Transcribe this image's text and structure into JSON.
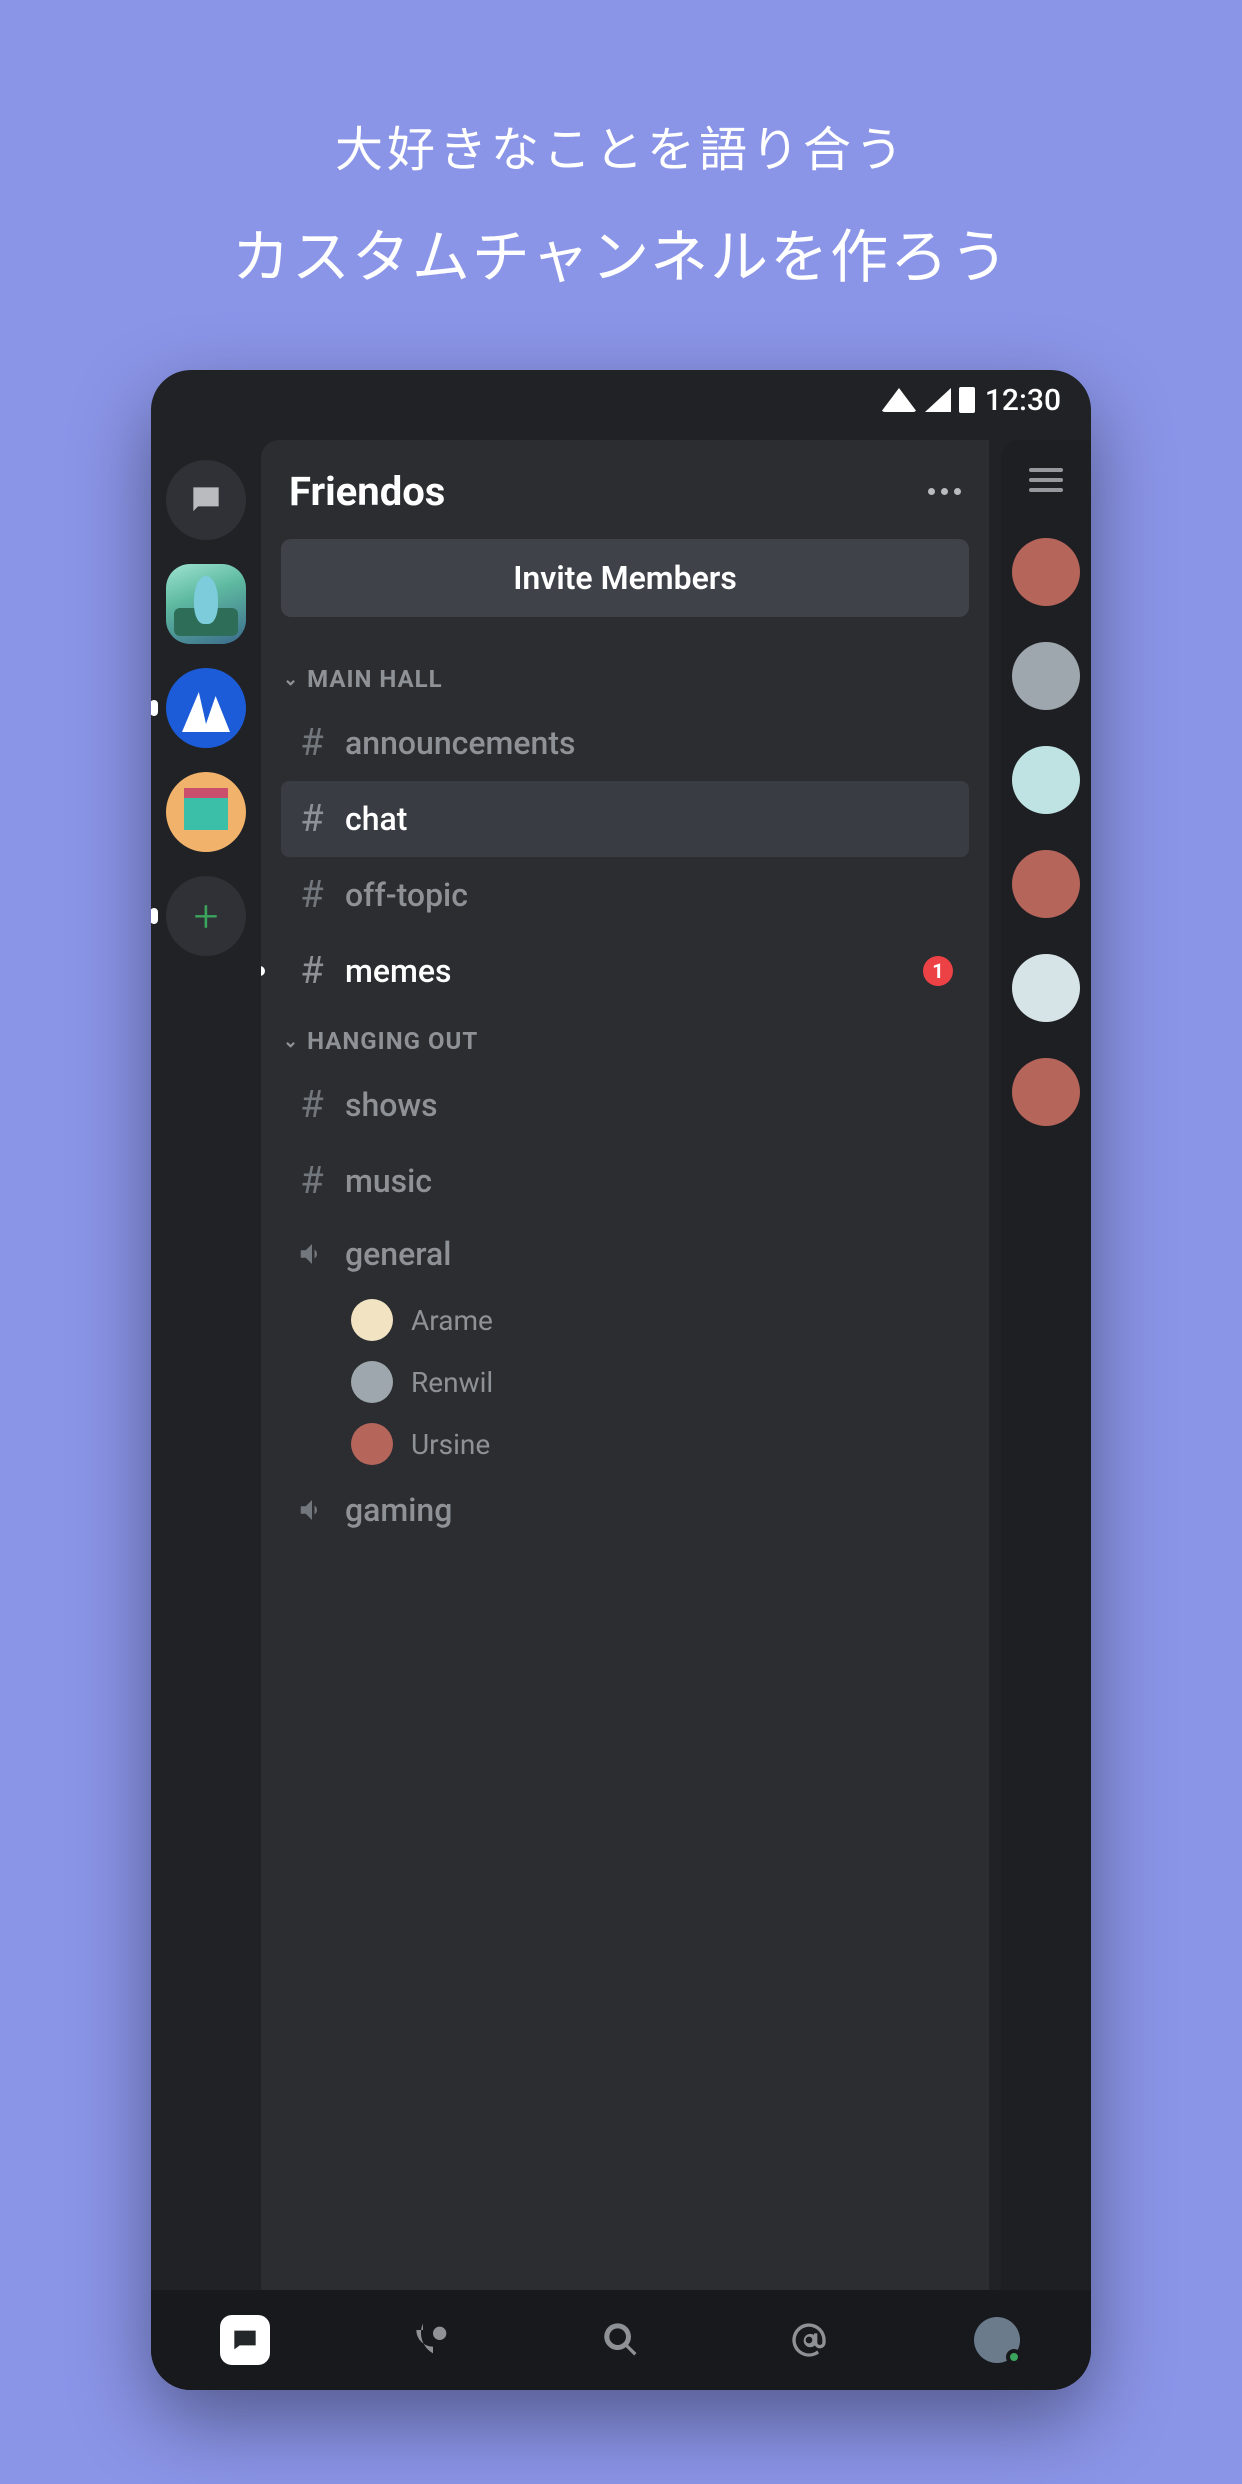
{
  "promo": {
    "line1": "大好きなことを語り合う",
    "line2": "カスタムチャンネルを作ろう"
  },
  "statusbar": {
    "time": "12:30"
  },
  "server": {
    "name": "Friendos",
    "invite_label": "Invite Members"
  },
  "categories": [
    {
      "name": "MAIN HALL",
      "channels": [
        {
          "type": "text",
          "name": "announcements",
          "active": false,
          "unread": false
        },
        {
          "type": "text",
          "name": "chat",
          "active": true,
          "unread": false
        },
        {
          "type": "text",
          "name": "off-topic",
          "active": false,
          "unread": false
        },
        {
          "type": "text",
          "name": "memes",
          "active": false,
          "unread": true,
          "badge": "1"
        }
      ]
    },
    {
      "name": "HANGING OUT",
      "channels": [
        {
          "type": "text",
          "name": "shows",
          "active": false,
          "unread": false
        },
        {
          "type": "text",
          "name": "music",
          "active": false,
          "unread": false
        },
        {
          "type": "voice",
          "name": "general",
          "members": [
            "Arame",
            "Renwil",
            "Ursine"
          ]
        },
        {
          "type": "voice",
          "name": "gaming",
          "members": []
        }
      ]
    }
  ],
  "nav": {
    "discord": "discord",
    "friends": "friends",
    "search": "search",
    "mentions": "mentions",
    "profile": "profile"
  }
}
